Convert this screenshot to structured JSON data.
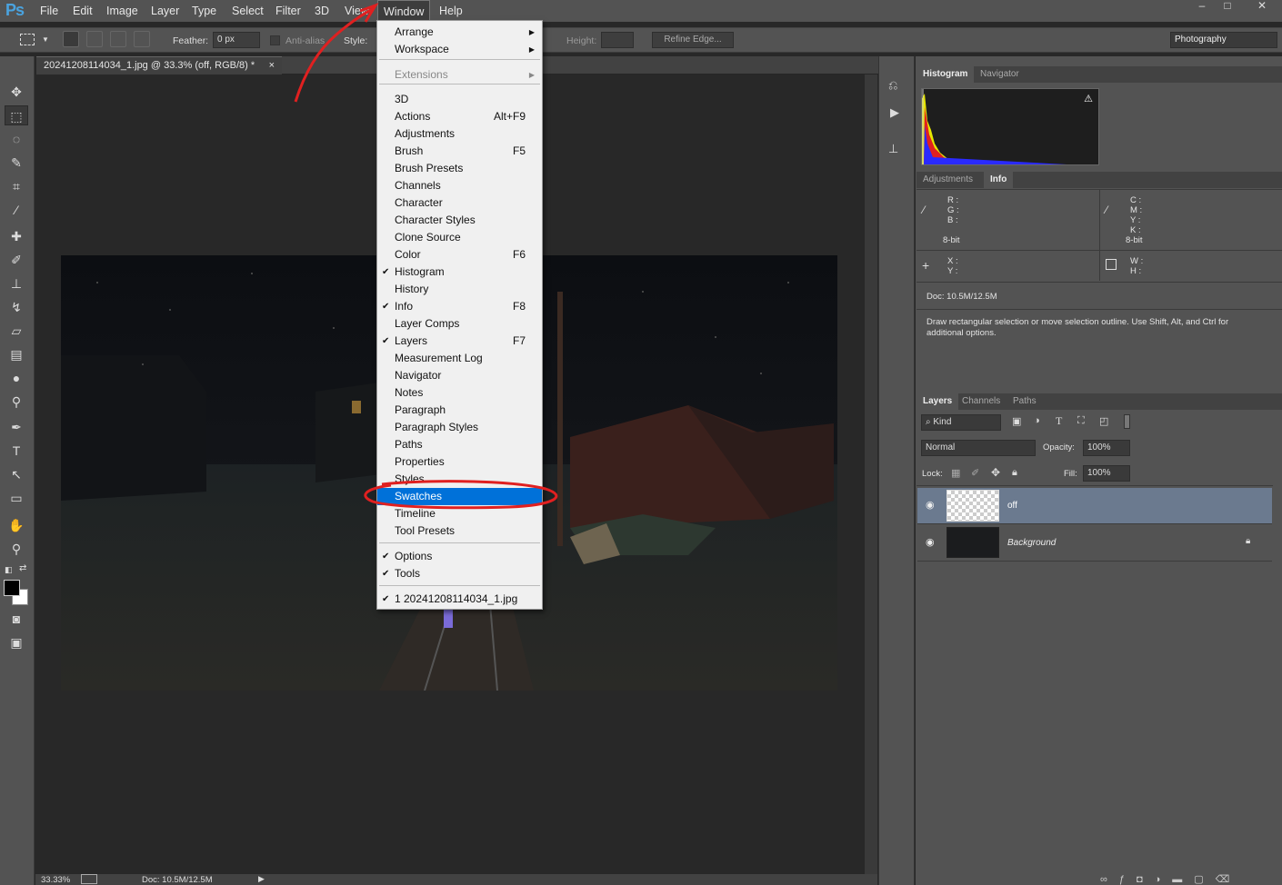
{
  "app": {
    "logo": "Ps"
  },
  "menubar": {
    "items": [
      "File",
      "Edit",
      "Image",
      "Layer",
      "Type",
      "Select",
      "Filter",
      "3D",
      "View",
      "Window",
      "Help"
    ],
    "window_controls": [
      "–",
      "□",
      "✕"
    ]
  },
  "options": {
    "feather_label": "Feather:",
    "feather_value": "0 px",
    "antialias_label": "Anti-alias",
    "style_label": "Style:",
    "height_label": "Height:",
    "refine_edge": "Refine Edge...",
    "workspace": "Photography"
  },
  "document": {
    "tab_title": "20241208114034_1.jpg @ 33.3% (off, RGB/8) *",
    "tab_close": "×"
  },
  "status": {
    "zoom": "33.33%",
    "doc": "Doc: 10.5M/12.5M"
  },
  "window_menu": {
    "items": [
      {
        "label": "Arrange",
        "shortcut": "",
        "checked": false,
        "submenu": true
      },
      {
        "label": "Workspace",
        "shortcut": "",
        "checked": false,
        "submenu": true
      },
      {
        "label": "Extensions",
        "shortcut": "",
        "checked": false,
        "submenu": true,
        "disabled": true
      },
      {
        "label": "3D",
        "shortcut": ""
      },
      {
        "label": "Actions",
        "shortcut": "Alt+F9"
      },
      {
        "label": "Adjustments",
        "shortcut": ""
      },
      {
        "label": "Brush",
        "shortcut": "F5"
      },
      {
        "label": "Brush Presets",
        "shortcut": ""
      },
      {
        "label": "Channels",
        "shortcut": ""
      },
      {
        "label": "Character",
        "shortcut": ""
      },
      {
        "label": "Character Styles",
        "shortcut": ""
      },
      {
        "label": "Clone Source",
        "shortcut": ""
      },
      {
        "label": "Color",
        "shortcut": "F6"
      },
      {
        "label": "Histogram",
        "shortcut": "",
        "checked": true
      },
      {
        "label": "History",
        "shortcut": ""
      },
      {
        "label": "Info",
        "shortcut": "F8",
        "checked": true
      },
      {
        "label": "Layer Comps",
        "shortcut": ""
      },
      {
        "label": "Layers",
        "shortcut": "F7",
        "checked": true
      },
      {
        "label": "Measurement Log",
        "shortcut": ""
      },
      {
        "label": "Navigator",
        "shortcut": ""
      },
      {
        "label": "Notes",
        "shortcut": ""
      },
      {
        "label": "Paragraph",
        "shortcut": ""
      },
      {
        "label": "Paragraph Styles",
        "shortcut": ""
      },
      {
        "label": "Paths",
        "shortcut": ""
      },
      {
        "label": "Properties",
        "shortcut": ""
      },
      {
        "label": "Styles",
        "shortcut": ""
      },
      {
        "label": "Swatches",
        "shortcut": "",
        "highlighted": true
      },
      {
        "label": "Timeline",
        "shortcut": ""
      },
      {
        "label": "Tool Presets",
        "shortcut": ""
      },
      {
        "label": "Options",
        "shortcut": "",
        "checked": true
      },
      {
        "label": "Tools",
        "shortcut": "",
        "checked": true
      },
      {
        "label": "1 20241208114034_1.jpg",
        "shortcut": "",
        "checked": true
      }
    ]
  },
  "histogram_panel": {
    "tabs": [
      "Histogram",
      "Navigator"
    ],
    "warning": "⚠"
  },
  "info_panel": {
    "tabs": [
      "Adjustments",
      "Info"
    ],
    "rgb_labels": "R :\nG :\nB :",
    "cmyk_labels": "C :\nM :\nY :\nK :",
    "bit_left": "8-bit",
    "bit_right": "8-bit",
    "xy_labels": "X :\nY :",
    "wh_labels": "W :\nH :",
    "doc": "Doc: 10.5M/12.5M",
    "hint": "Draw rectangular selection or move selection outline.  Use Shift, Alt, and Ctrl for additional options."
  },
  "layers_panel": {
    "tabs": [
      "Layers",
      "Channels",
      "Paths"
    ],
    "kind": "Kind",
    "blend_mode": "Normal",
    "opacity_label": "Opacity:",
    "opacity": "100%",
    "lock_label": "Lock:",
    "fill_label": "Fill:",
    "fill": "100%",
    "layers": [
      {
        "name": "off",
        "selected": true
      },
      {
        "name": "Background",
        "locked": true
      }
    ]
  },
  "colors": {
    "menu_highlight": "#0071d9",
    "annotation": "#e02020",
    "layer_selected": "#6b7a8f"
  }
}
